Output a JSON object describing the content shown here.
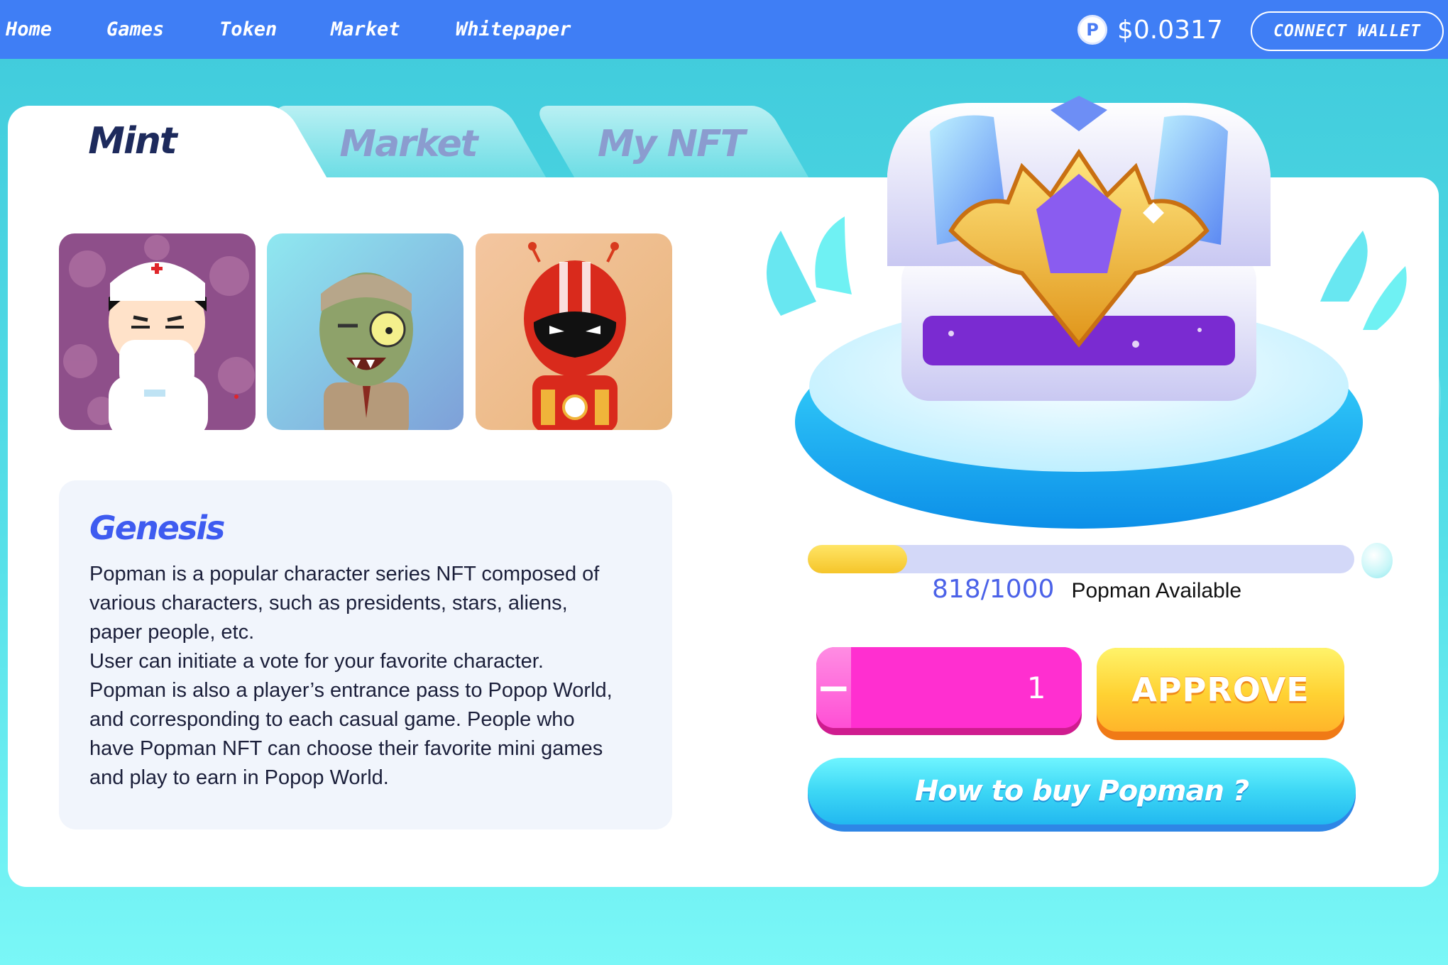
{
  "nav": {
    "links": [
      {
        "label": "Home"
      },
      {
        "label": "Games"
      },
      {
        "label": "Token"
      },
      {
        "label": "Market"
      },
      {
        "label": "Whitepaper"
      }
    ],
    "token_price": "$0.0317",
    "connect_wallet": "CONNECT WALLET"
  },
  "tabs": [
    {
      "label": "Mint",
      "active": true
    },
    {
      "label": "Market",
      "active": false
    },
    {
      "label": "My NFT",
      "active": false
    }
  ],
  "nfts": [
    {
      "name": "nurse-popman"
    },
    {
      "name": "zombie-popman"
    },
    {
      "name": "robot-popman"
    }
  ],
  "description": {
    "title": "Genesis",
    "lines": [
      "Popman is a popular character series NFT composed of",
      "various characters, such as presidents, stars, aliens,",
      "paper people, etc.",
      "User can initiate a vote for your favorite character.",
      "Popman is also a player’s entrance pass to Popop World,",
      "and corresponding to each casual game. People who",
      "have Popman NFT can choose their favorite mini games",
      "and play to earn in Popop World."
    ]
  },
  "mint": {
    "available_count": "818/1000",
    "available_label": "Popman Available",
    "progress_fraction": 0.182,
    "quantity": "1",
    "minus_label": "−",
    "plus_label": "+",
    "approve_label": "APPROVE",
    "howto_label": "How to buy Popman ?"
  },
  "colors": {
    "nav_bg": "#3f7ef5",
    "accent_blue": "#3e5bf0",
    "stepper_pink": "#ff3cd4",
    "approve_yellow": "#ffd233",
    "howto_cyan": "#3dd7f5"
  }
}
